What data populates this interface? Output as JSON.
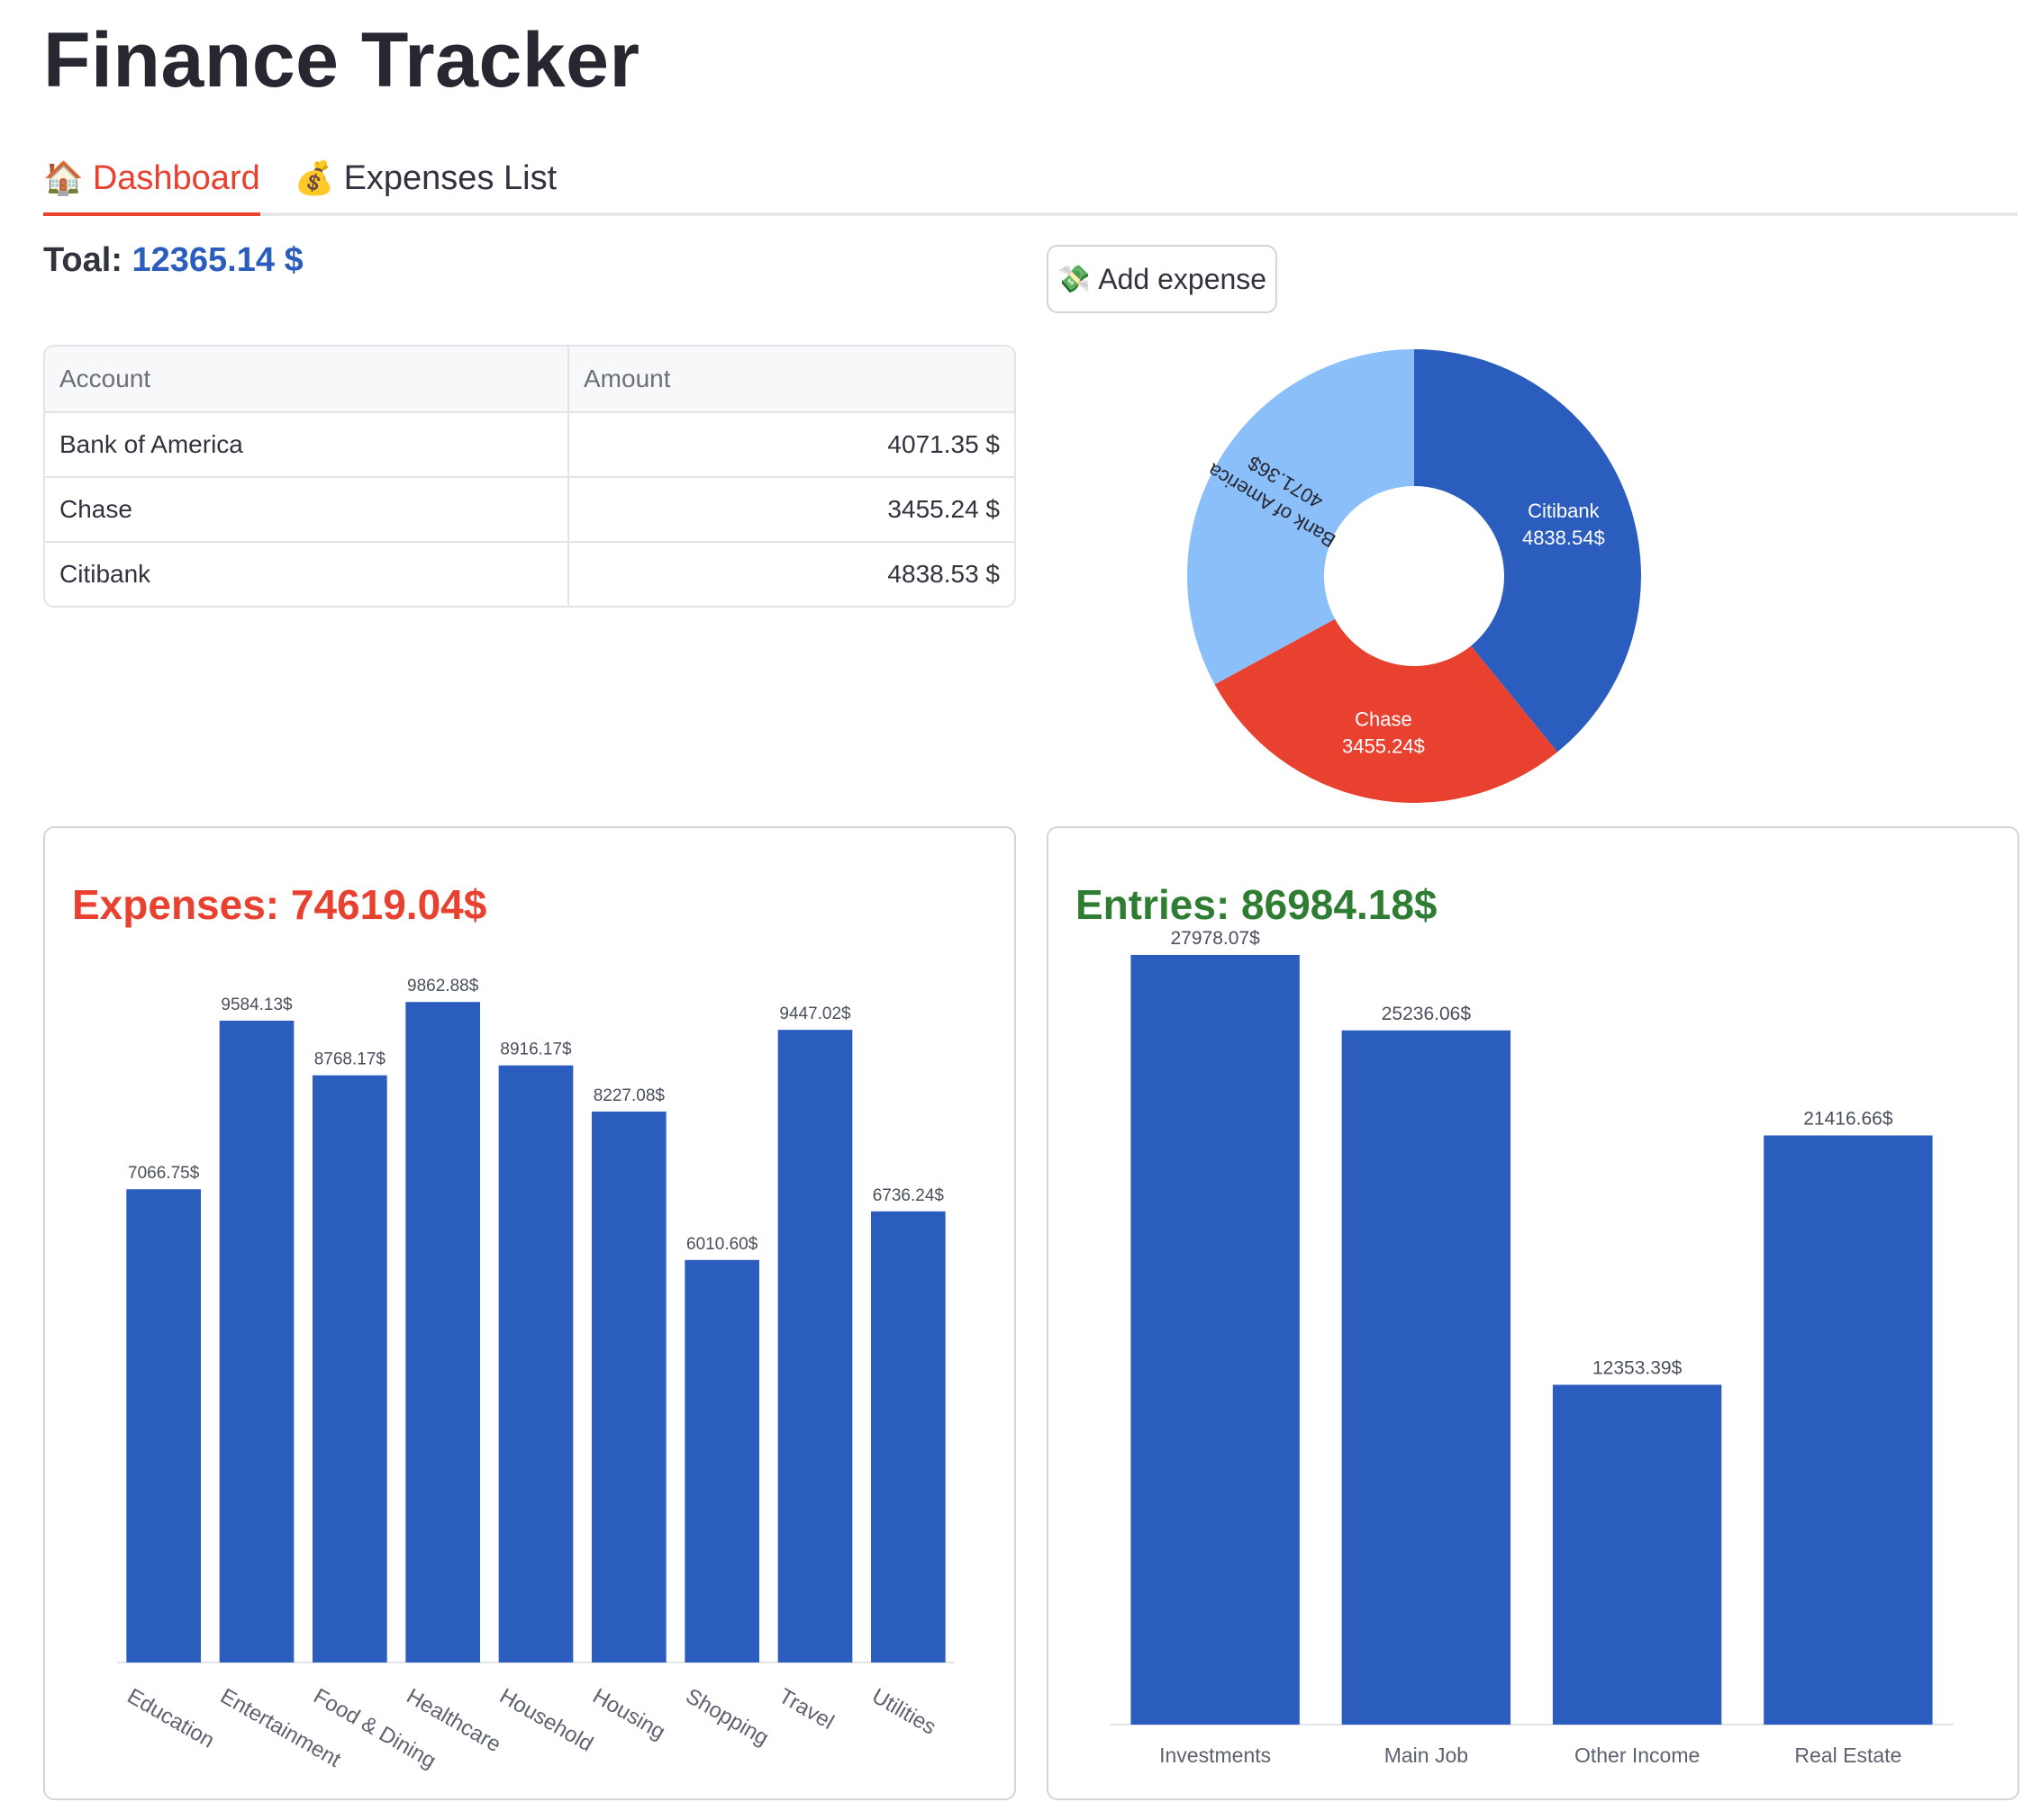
{
  "app": {
    "title": "Finance Tracker"
  },
  "tabs": [
    {
      "icon": "house-icon",
      "emoji": "🏠",
      "label": "Dashboard",
      "active": true
    },
    {
      "icon": "money-bag-icon",
      "emoji": "💰",
      "label": "Expenses List",
      "active": false
    }
  ],
  "summary": {
    "total_label": "Toal:",
    "total_value": "12365.14 $"
  },
  "add_button": {
    "icon": "money-with-wings-icon",
    "emoji": "💸",
    "label": "Add expense"
  },
  "accounts_table": {
    "headers": [
      "Account",
      "Amount"
    ],
    "rows": [
      {
        "account": "Bank of America",
        "amount": "4071.35 $"
      },
      {
        "account": "Chase",
        "amount": "3455.24 $"
      },
      {
        "account": "Citibank",
        "amount": "4838.53 $"
      }
    ]
  },
  "colors": {
    "accent_red": "#e8412f",
    "bar_blue": "#2a5dbd",
    "light_blue": "#8bbff9",
    "entries_green": "#2e7d32"
  },
  "chart_data": [
    {
      "type": "pie",
      "donut": true,
      "slices": [
        {
          "label": "Citibank",
          "value": 4838.54,
          "value_label": "4838.54$",
          "color": "#2a5dbd"
        },
        {
          "label": "Chase",
          "value": 3455.24,
          "value_label": "3455.24$",
          "color": "#e8412f"
        },
        {
          "label": "Bank of America",
          "value": 4071.36,
          "value_label": "4071.36$",
          "color": "#8bbff9"
        }
      ]
    },
    {
      "type": "bar",
      "title": "Expenses: 74619.04$",
      "categories": [
        "Education",
        "Entertainment",
        "Food & Dining",
        "Healthcare",
        "Household",
        "Housing",
        "Shopping",
        "Travel",
        "Utilities"
      ],
      "values": [
        7066.75,
        9584.13,
        8768.17,
        9862.88,
        8916.17,
        8227.08,
        6010.6,
        9447.02,
        6736.24
      ],
      "value_labels": [
        "7066.75$",
        "9584.13$",
        "8768.17$",
        "9862.88$",
        "8916.17$",
        "8227.08$",
        "6010.60$",
        "9447.02$",
        "6736.24$"
      ],
      "xlabel": "",
      "ylabel": "",
      "ylim": [
        0,
        10000
      ],
      "grid": false,
      "color": "#2a5dbd",
      "tick_rotation": 30
    },
    {
      "type": "bar",
      "title": "Entries: 86984.18$",
      "categories": [
        "Investments",
        "Main Job",
        "Other Income",
        "Real Estate"
      ],
      "values": [
        27978.07,
        25236.06,
        12353.39,
        21416.66
      ],
      "value_labels": [
        "27978.07$",
        "25236.06$",
        "12353.39$",
        "21416.66$"
      ],
      "xlabel": "",
      "ylabel": "",
      "ylim": [
        0,
        28500
      ],
      "grid": false,
      "color": "#2a5dbd",
      "tick_rotation": 0
    }
  ]
}
